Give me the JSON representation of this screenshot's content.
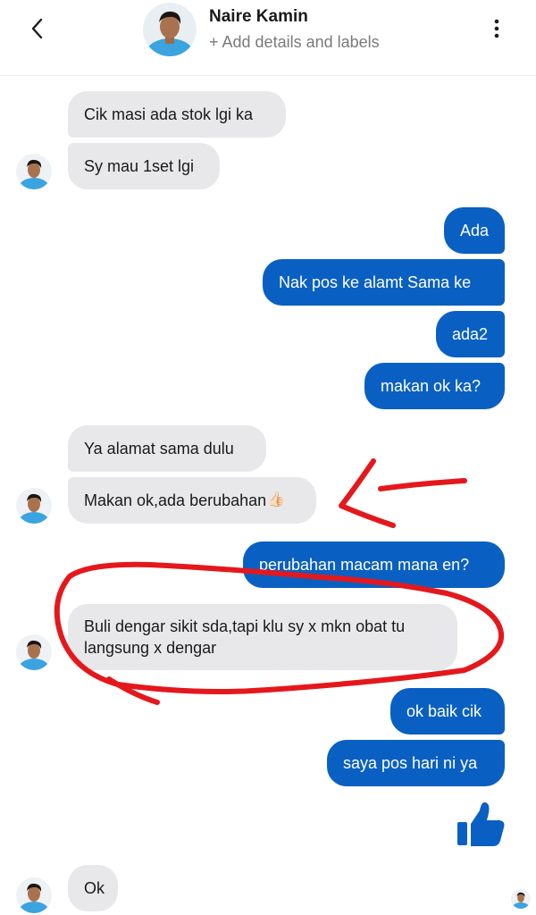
{
  "header": {
    "contact_name": "Naire Kamin",
    "subtitle": "+ Add details and labels",
    "back_icon": "chevron-left-icon",
    "menu_icon": "more-vertical-icon"
  },
  "colors": {
    "outgoing_bubble": "#0a60c2",
    "incoming_bubble": "#e8e8ea",
    "annotation": "#e4181c",
    "like": "#0a60c2"
  },
  "messages": [
    {
      "direction": "incoming",
      "text": "Cik masi ada stok lgi ka"
    },
    {
      "direction": "incoming",
      "text": "Sy mau 1set lgi"
    },
    {
      "direction": "outgoing",
      "text": "Ada"
    },
    {
      "direction": "outgoing",
      "text": "Nak pos ke alamt Sama ke"
    },
    {
      "direction": "outgoing",
      "text": "ada2"
    },
    {
      "direction": "outgoing",
      "text": "makan ok ka?"
    },
    {
      "direction": "incoming",
      "text": "Ya alamat sama dulu"
    },
    {
      "direction": "incoming",
      "text": "Makan ok,ada berubahan",
      "emoji": "👍🏻"
    },
    {
      "direction": "outgoing",
      "text": "perubahan macam mana en?"
    },
    {
      "direction": "incoming",
      "text": "Buli dengar sikit sda,tapi klu sy x mkn obat tu langsung x dengar"
    },
    {
      "direction": "outgoing",
      "text": "ok baik cik"
    },
    {
      "direction": "outgoing",
      "text": "saya pos hari ni ya"
    },
    {
      "direction": "outgoing",
      "type": "like",
      "icon": "thumbs-up-icon"
    },
    {
      "direction": "incoming",
      "text": "Ok"
    }
  ]
}
